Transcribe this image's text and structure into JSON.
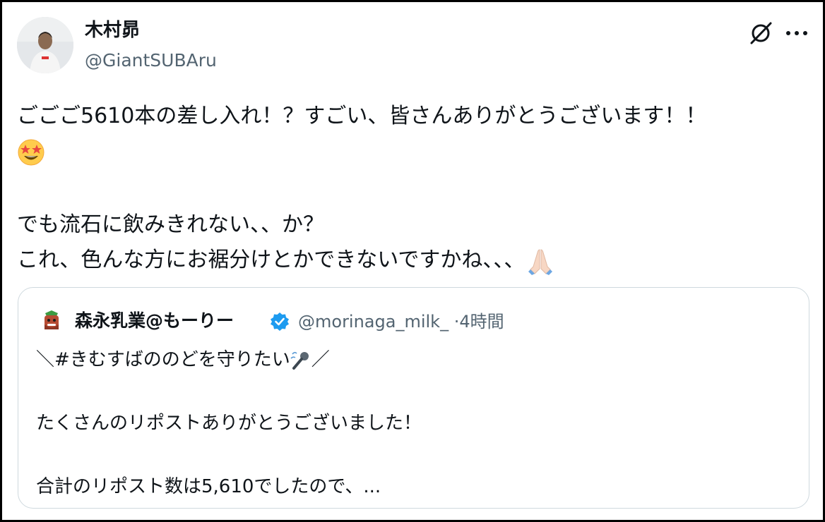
{
  "author": {
    "name": "木村昴",
    "handle": "@GiantSUBAru",
    "avatar_icon": "user-avatar"
  },
  "actions": {
    "grok_icon": "grok-icon",
    "more_icon": "more-icon"
  },
  "tweet": {
    "line1": "ごごご5610本の差し入れ！？すごい、皆さんありがとうございます！！",
    "line2_emoji": "star-struck-emoji",
    "line3": "でも流石に飲みきれない、、か？",
    "line4": "これ、色んな方にお裾分けとかできないですかね、、、",
    "line4_emoji": "folded-hands-emoji"
  },
  "quoted": {
    "name": "森永乳業@もーりー",
    "verified_icon": "verified-badge-icon",
    "handle": "@morinaga_milk_",
    "separator": "·",
    "time": "4時間",
    "line1_prefix": "＼#きむすばののどを守りたい",
    "line1_emoji": "microphone-emoji",
    "line1_suffix": "／",
    "line2": "たくさんのリポストありがとうございました！",
    "line3": "合計のリポスト数は5,610でしたので、..."
  },
  "colors": {
    "text": "#0f1419",
    "secondary": "#536471",
    "border": "#cfd9de",
    "verified": "#1d9bf0"
  }
}
